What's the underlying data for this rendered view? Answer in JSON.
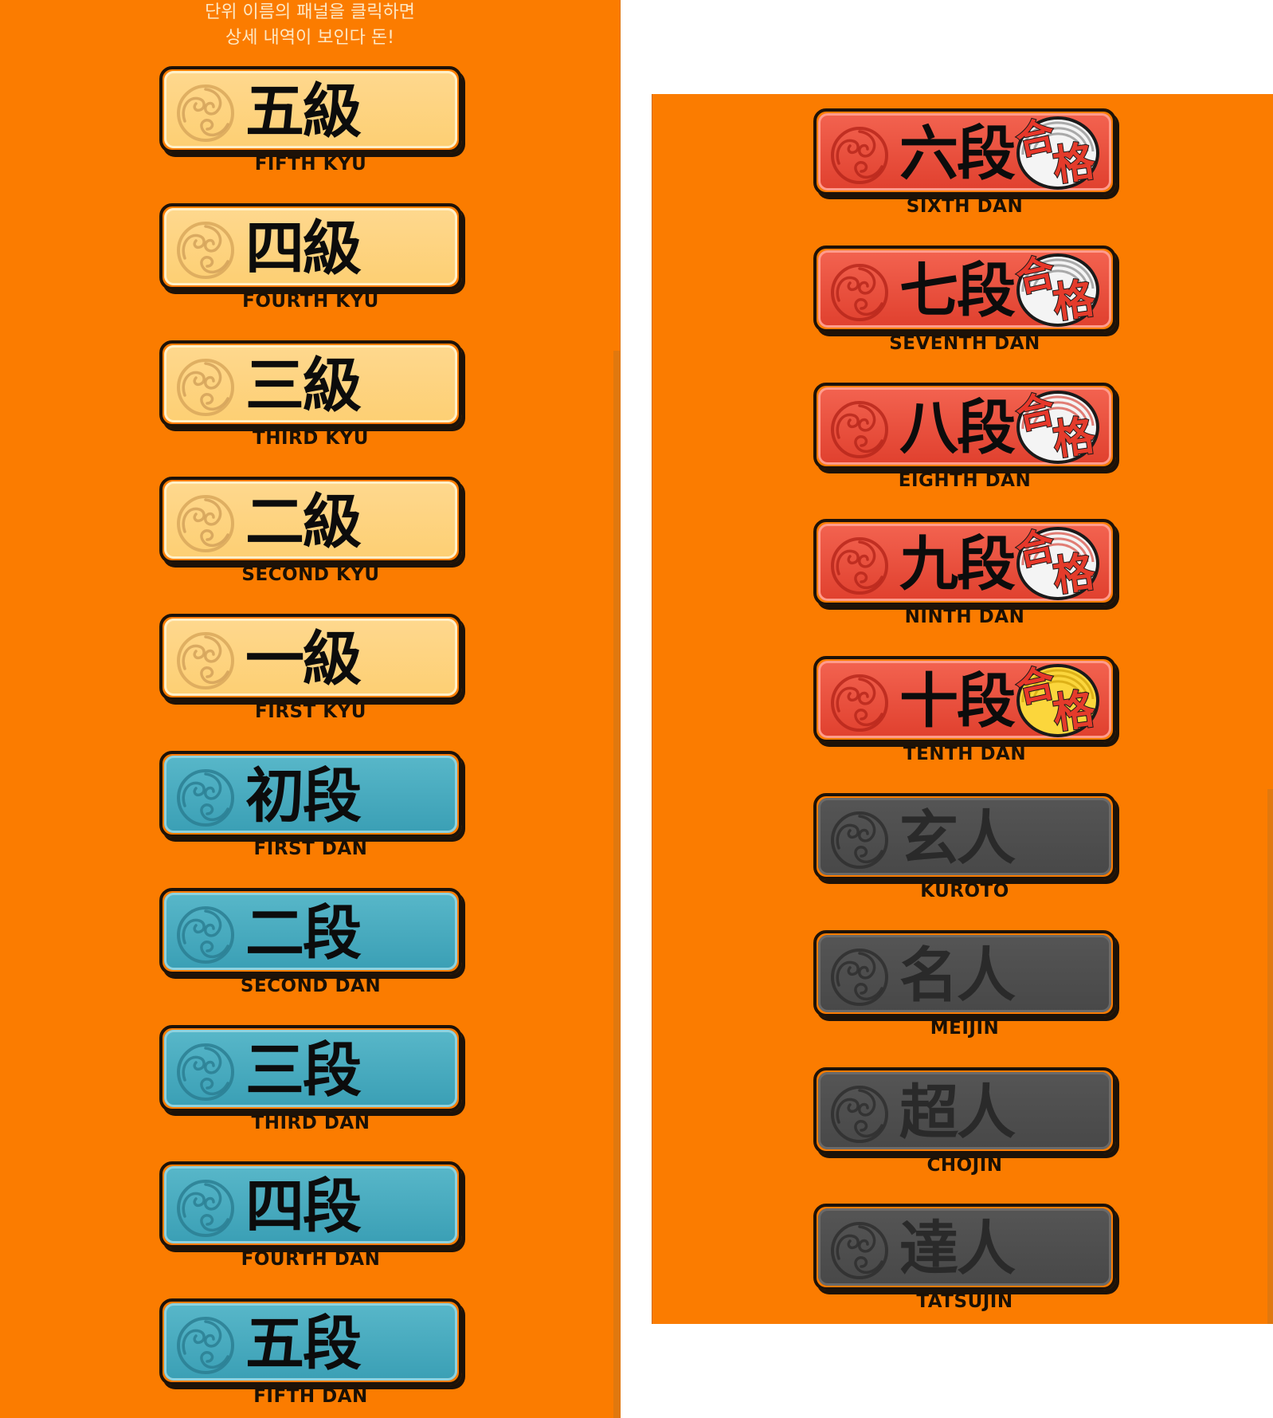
{
  "instructions": {
    "line1": "단위 이름의 패널을 클릭하면",
    "line2": "상세 내역이 보인다 돈!"
  },
  "left_column": [
    {
      "kanji": "五級",
      "label": "FIFTH KYU",
      "tier": "kyu"
    },
    {
      "kanji": "四級",
      "label": "FOURTH KYU",
      "tier": "kyu"
    },
    {
      "kanji": "三級",
      "label": "THIRD KYU",
      "tier": "kyu"
    },
    {
      "kanji": "二級",
      "label": "SECOND KYU",
      "tier": "kyu"
    },
    {
      "kanji": "一級",
      "label": "FIRST KYU",
      "tier": "kyu"
    },
    {
      "kanji": "初段",
      "label": "FIRST DAN",
      "tier": "dan"
    },
    {
      "kanji": "二段",
      "label": "SECOND DAN",
      "tier": "dan"
    },
    {
      "kanji": "三段",
      "label": "THIRD DAN",
      "tier": "dan"
    },
    {
      "kanji": "四段",
      "label": "FOURTH DAN",
      "tier": "dan"
    },
    {
      "kanji": "五段",
      "label": "FIFTH DAN",
      "tier": "dan"
    }
  ],
  "right_column": [
    {
      "kanji": "六段",
      "label": "SIXTH DAN",
      "tier": "high",
      "seal": "合格",
      "seal_variant": "silver"
    },
    {
      "kanji": "七段",
      "label": "SEVENTH DAN",
      "tier": "high",
      "seal": "合格",
      "seal_variant": "silver"
    },
    {
      "kanji": "八段",
      "label": "EIGHTH DAN",
      "tier": "high",
      "seal": "合格",
      "seal_variant": "red"
    },
    {
      "kanji": "九段",
      "label": "NINTH DAN",
      "tier": "high",
      "seal": "合格",
      "seal_variant": "red"
    },
    {
      "kanji": "十段",
      "label": "TENTH DAN",
      "tier": "high",
      "seal": "合格",
      "seal_variant": "gold"
    },
    {
      "kanji": "玄人",
      "label": "KUROTO",
      "tier": "master"
    },
    {
      "kanji": "名人",
      "label": "MEIJIN",
      "tier": "master"
    },
    {
      "kanji": "超人",
      "label": "CHOJIN",
      "tier": "master"
    },
    {
      "kanji": "達人",
      "label": "TATSUJIN",
      "tier": "master"
    }
  ],
  "colors": {
    "background_orange": "#fb7c00",
    "kyu_panel": "#fdd27b",
    "dan_panel": "#46a9bd",
    "high_panel": "#e94a37",
    "master_panel": "#4d4d4d",
    "outline": "#1d1208"
  },
  "icons": {
    "crest": "tomoe-crest-icon",
    "seal": "pass-seal-icon"
  }
}
